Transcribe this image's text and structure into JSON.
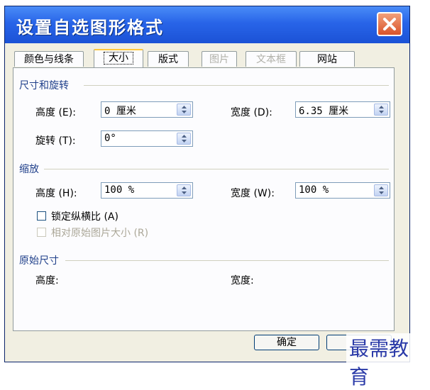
{
  "window": {
    "title": "设置自选图形格式"
  },
  "tabs": [
    {
      "label": "颜色与线条",
      "state": "normal"
    },
    {
      "label": "大小",
      "state": "active"
    },
    {
      "label": "版式",
      "state": "normal"
    },
    {
      "label": "图片",
      "state": "disabled"
    },
    {
      "label": "文本框",
      "state": "disabled"
    },
    {
      "label": "网站",
      "state": "normal"
    }
  ],
  "size_rotate": {
    "section_title": "尺寸和旋转",
    "height_label": "高度 (E):",
    "height_value": "0 厘米",
    "width_label": "宽度 (D):",
    "width_value": "6.35 厘米",
    "rotation_label": "旋转 (T):",
    "rotation_value": "0°"
  },
  "scale": {
    "section_title": "缩放",
    "height_label": "高度 (H):",
    "height_value": "100 %",
    "width_label": "宽度 (W):",
    "width_value": "100 %",
    "lock_aspect_label": "锁定纵横比 (A)",
    "relative_label": "相对原始图片大小 (R)"
  },
  "original": {
    "section_title": "原始尺寸",
    "height_label": "高度:",
    "width_label": "宽度:"
  },
  "buttons": {
    "ok_label": "确定"
  },
  "watermark": "最需教育",
  "colors": {
    "titlebar": "#2864e8",
    "close": "#d9532a",
    "section_title": "#1f3f8a"
  }
}
